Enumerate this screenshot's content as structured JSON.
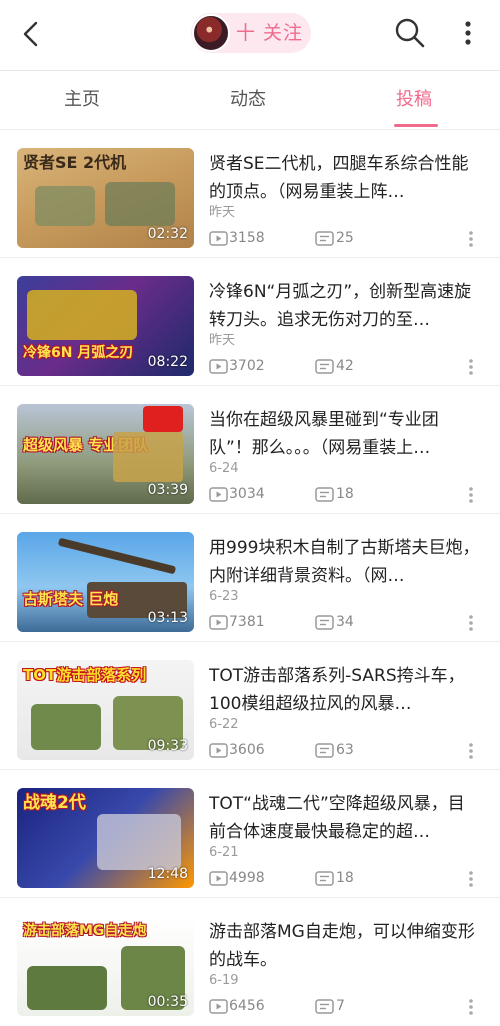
{
  "header": {
    "back_icon": "back-arrow-icon",
    "follow_label": "十 关注",
    "search_icon": "search-icon",
    "more_icon": "more-vertical-icon",
    "accent_color": "#f06b8e"
  },
  "tabs": [
    {
      "label": "主页",
      "active": false
    },
    {
      "label": "动态",
      "active": false
    },
    {
      "label": "投稿",
      "active": true
    }
  ],
  "videos": [
    {
      "thumb_text": "贤者SE 2代机",
      "duration": "02:32",
      "title": "贤者SE二代机，四腿车系综合性能的顶点。（网易重装上阵…",
      "date": "昨天",
      "views": "3158",
      "danmaku": "25"
    },
    {
      "thumb_text": "冷锋6N 月弧之刃",
      "duration": "08:22",
      "title": "冷锋6N“月弧之刃”，创新型高速旋转刀头。追求无伤对刀的至…",
      "date": "昨天",
      "views": "3702",
      "danmaku": "42"
    },
    {
      "thumb_text": "超级风暴 专业团队",
      "duration": "03:39",
      "title": "当你在超级风暴里碰到“专业团队”！那么。。。（网易重装上…",
      "date": "6-24",
      "views": "3034",
      "danmaku": "18"
    },
    {
      "thumb_text": "古斯塔夫 巨炮",
      "duration": "03:13",
      "title": "用999块积木自制了古斯塔夫巨炮，内附详细背景资料。（网…",
      "date": "6-23",
      "views": "7381",
      "danmaku": "34"
    },
    {
      "thumb_text": "TOT游击部落系列",
      "duration": "09:33",
      "title": "TOT游击部落系列-SARS挎斗车，100模组超级拉风的风暴…",
      "date": "6-22",
      "views": "3606",
      "danmaku": "63"
    },
    {
      "thumb_text": "战魂2代",
      "duration": "12:48",
      "title": "TOT“战魂二代”空降超级风暴，目前合体速度最快最稳定的超…",
      "date": "6-21",
      "views": "4998",
      "danmaku": "18"
    },
    {
      "thumb_text": "游击部落MG自走炮",
      "duration": "00:35",
      "title": "游击部落MG自走炮，可以伸缩变形的战车。",
      "date": "6-19",
      "views": "6456",
      "danmaku": "7"
    }
  ]
}
